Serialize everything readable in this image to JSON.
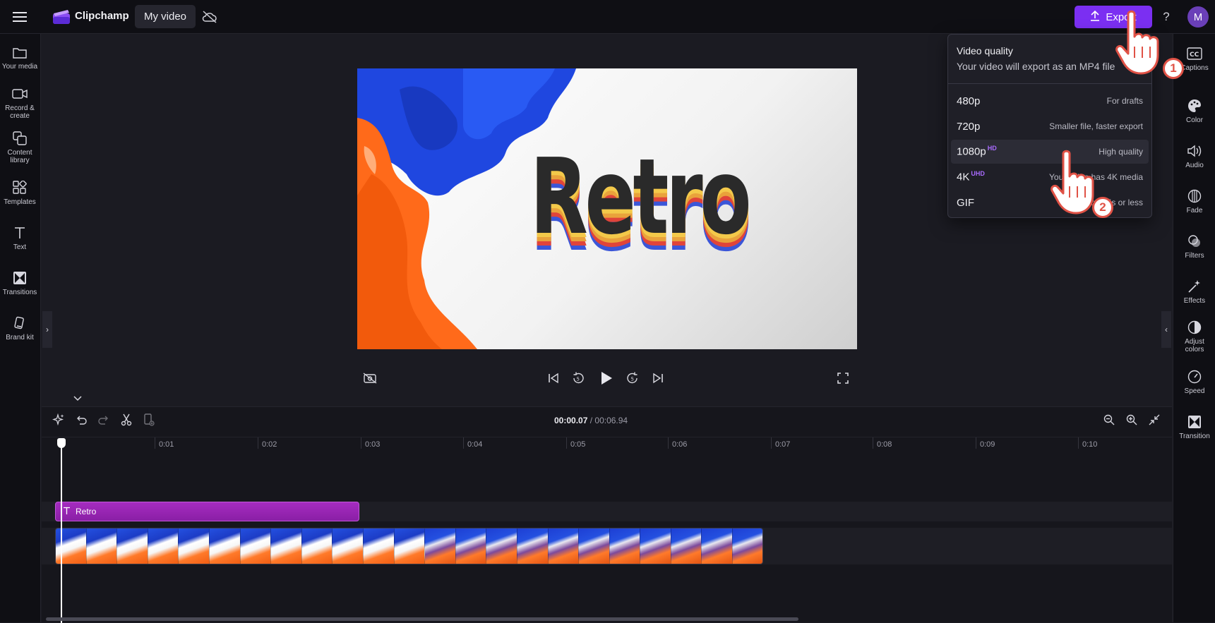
{
  "app": {
    "name": "Clipchamp",
    "project_name": "My video"
  },
  "header": {
    "export_label": "Export",
    "help_label": "?",
    "avatar_initial": "M"
  },
  "left_rail": [
    {
      "label": "Your media",
      "icon": "folder-icon"
    },
    {
      "label": "Record & create",
      "icon": "camera-icon"
    },
    {
      "label": "Content library",
      "icon": "library-icon"
    },
    {
      "label": "Templates",
      "icon": "templates-icon"
    },
    {
      "label": "Text",
      "icon": "text-icon"
    },
    {
      "label": "Transitions",
      "icon": "transitions-icon"
    },
    {
      "label": "Brand kit",
      "icon": "brand-kit-icon"
    }
  ],
  "right_rail": [
    {
      "label": "Captions",
      "icon": "captions-icon"
    },
    {
      "label": "Color",
      "icon": "palette-icon"
    },
    {
      "label": "Audio",
      "icon": "speaker-icon"
    },
    {
      "label": "Fade",
      "icon": "fade-icon"
    },
    {
      "label": "Filters",
      "icon": "filters-icon"
    },
    {
      "label": "Effects",
      "icon": "magic-wand-icon"
    },
    {
      "label": "Adjust colors",
      "icon": "adjust-icon"
    },
    {
      "label": "Speed",
      "icon": "speedometer-icon"
    },
    {
      "label": "Transition",
      "icon": "transition-icon"
    }
  ],
  "preview": {
    "overlay_text": "Retro"
  },
  "export_menu": {
    "title": "Video quality",
    "subtitle": "Your video will export as an MP4 file",
    "options": [
      {
        "name": "480p",
        "badge": "",
        "desc": "For drafts"
      },
      {
        "name": "720p",
        "badge": "",
        "desc": "Smaller file, faster export"
      },
      {
        "name": "1080p",
        "badge": "HD",
        "desc": "High quality"
      },
      {
        "name": "4K",
        "badge": "UHD",
        "desc": "Your video has 4K media"
      },
      {
        "name": "GIF",
        "badge": "",
        "desc": "For videos 15s or less"
      }
    ]
  },
  "timeline": {
    "current_time": "00:00.07",
    "separator": " / ",
    "total_time": "00:06.94",
    "ticks": [
      "0:01",
      "0:02",
      "0:03",
      "0:04",
      "0:05",
      "0:06",
      "0:07",
      "0:08",
      "0:09",
      "0:10"
    ],
    "text_clip_label": "Retro"
  },
  "annotations": {
    "step1": "1",
    "step2": "2"
  },
  "colors": {
    "accent": "#7b2ff2",
    "text_clip": "#9a23b5",
    "badge": "#a96bff",
    "annotation": "#e05246"
  }
}
